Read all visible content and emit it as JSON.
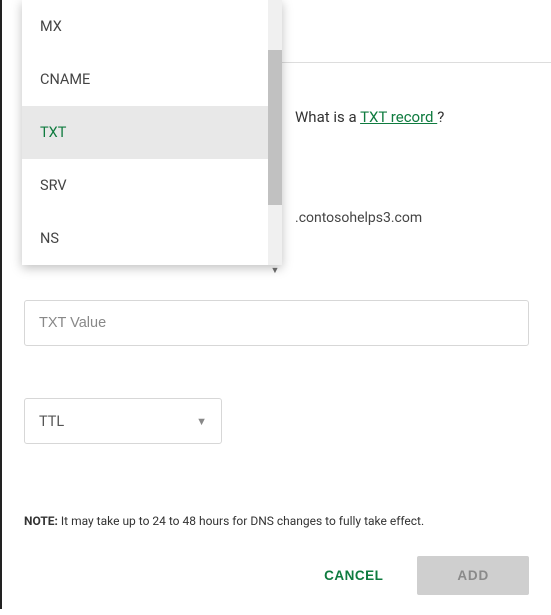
{
  "dropdown": {
    "items": [
      "MX",
      "CNAME",
      "TXT",
      "SRV",
      "NS"
    ],
    "selected_index": 2
  },
  "info": {
    "prefix": "What is a ",
    "link_text": "TXT record ",
    "suffix": "?"
  },
  "domain_suffix": ".contosohelps3.com",
  "txt_value": {
    "placeholder": "TXT Value",
    "value": ""
  },
  "ttl": {
    "label": "TTL"
  },
  "note": {
    "label": "NOTE:",
    "text": " It may take up to 24 to 48 hours for DNS changes to fully take effect."
  },
  "buttons": {
    "cancel": "CANCEL",
    "add": "ADD"
  }
}
